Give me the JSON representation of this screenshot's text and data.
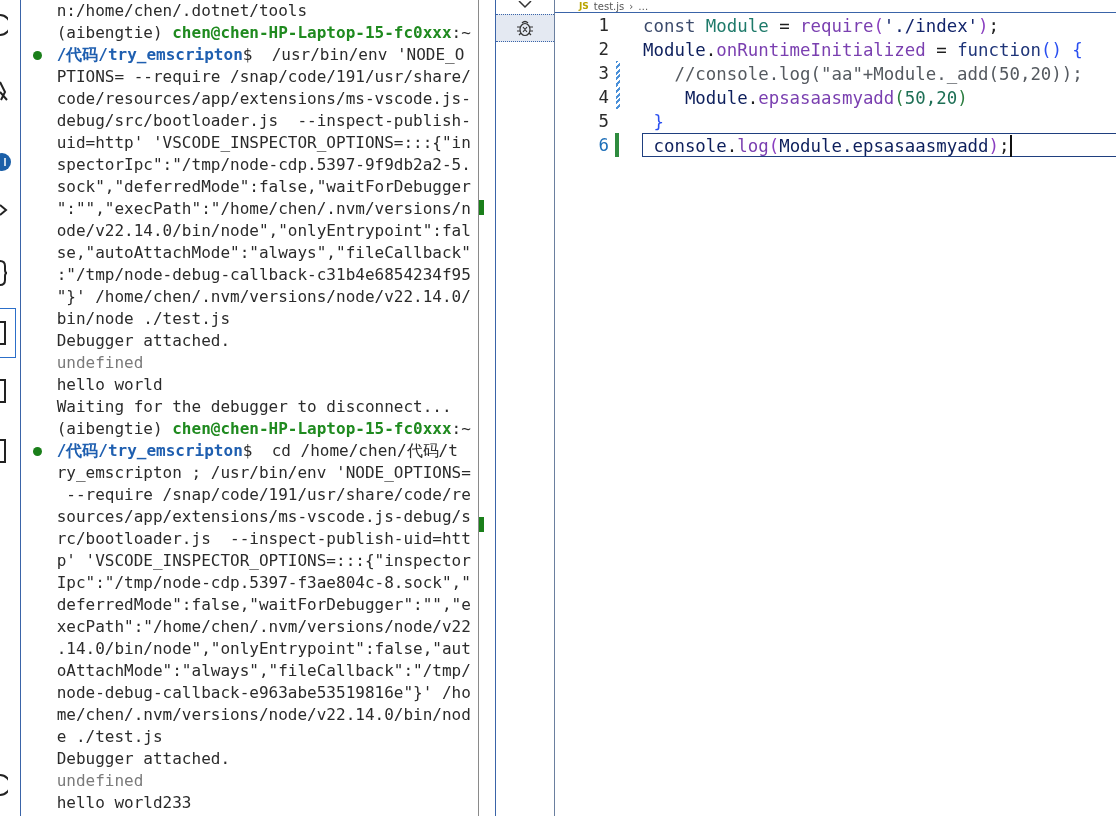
{
  "terminal": {
    "lines": [
      {
        "decoration": false,
        "segments": [
          {
            "text": "n:/home/chen/.dotnet/tools",
            "kind": "plain"
          }
        ]
      },
      {
        "decoration": false,
        "segments": [
          {
            "text": "(aibengtie) ",
            "kind": "plain"
          },
          {
            "text": "chen@chen-HP-Laptop-15-fc0xxx",
            "kind": "user"
          },
          {
            "text": ":~",
            "kind": "plain"
          }
        ]
      },
      {
        "decoration": true,
        "segments": [
          {
            "text": "/代码/try_emscripton",
            "kind": "path"
          },
          {
            "text": "$  /usr/bin/env 'NODE_O",
            "kind": "plain"
          }
        ]
      },
      {
        "decoration": false,
        "segments": [
          {
            "text": "PTIONS= --require /snap/code/191/usr/share/",
            "kind": "plain"
          }
        ]
      },
      {
        "decoration": false,
        "segments": [
          {
            "text": "code/resources/app/extensions/ms-vscode.js-",
            "kind": "plain"
          }
        ]
      },
      {
        "decoration": false,
        "segments": [
          {
            "text": "debug/src/bootloader.js  --inspect-publish-",
            "kind": "plain"
          }
        ]
      },
      {
        "decoration": false,
        "segments": [
          {
            "text": "uid=http' 'VSCODE_INSPECTOR_OPTIONS=:::{\"in",
            "kind": "plain"
          }
        ]
      },
      {
        "decoration": false,
        "segments": [
          {
            "text": "spectorIpc\":\"/tmp/node-cdp.5397-9f9db2a2-5.",
            "kind": "plain"
          }
        ]
      },
      {
        "decoration": false,
        "segments": [
          {
            "text": "sock\",\"deferredMode\":false,\"waitForDebugger",
            "kind": "plain"
          }
        ]
      },
      {
        "decoration": false,
        "segments": [
          {
            "text": "\":\"\",\"execPath\":\"/home/chen/.nvm/versions/n",
            "kind": "plain"
          }
        ]
      },
      {
        "decoration": false,
        "segments": [
          {
            "text": "ode/v22.14.0/bin/node\",\"onlyEntrypoint\":fal",
            "kind": "plain"
          }
        ]
      },
      {
        "decoration": false,
        "segments": [
          {
            "text": "se,\"autoAttachMode\":\"always\",\"fileCallback\"",
            "kind": "plain"
          }
        ]
      },
      {
        "decoration": false,
        "segments": [
          {
            "text": ":\"/tmp/node-debug-callback-c31b4e6854234f95",
            "kind": "plain"
          }
        ]
      },
      {
        "decoration": false,
        "segments": [
          {
            "text": "\"}' /home/chen/.nvm/versions/node/v22.14.0/",
            "kind": "plain"
          }
        ]
      },
      {
        "decoration": false,
        "segments": [
          {
            "text": "bin/node ./test.js",
            "kind": "plain"
          }
        ]
      },
      {
        "decoration": false,
        "segments": [
          {
            "text": "Debugger attached.",
            "kind": "plain"
          }
        ]
      },
      {
        "decoration": false,
        "segments": [
          {
            "text": "undefined",
            "kind": "dim"
          }
        ]
      },
      {
        "decoration": false,
        "segments": [
          {
            "text": "hello world",
            "kind": "plain"
          }
        ]
      },
      {
        "decoration": false,
        "segments": [
          {
            "text": "Waiting for the debugger to disconnect...",
            "kind": "plain"
          }
        ]
      },
      {
        "decoration": false,
        "segments": [
          {
            "text": "(aibengtie) ",
            "kind": "plain"
          },
          {
            "text": "chen@chen-HP-Laptop-15-fc0xxx",
            "kind": "user"
          },
          {
            "text": ":~",
            "kind": "plain"
          }
        ]
      },
      {
        "decoration": true,
        "segments": [
          {
            "text": "/代码/try_emscripton",
            "kind": "path"
          },
          {
            "text": "$  cd /home/chen/代码/t",
            "kind": "plain"
          }
        ]
      },
      {
        "decoration": false,
        "segments": [
          {
            "text": "ry_emscripton ; /usr/bin/env 'NODE_OPTIONS=",
            "kind": "plain"
          }
        ]
      },
      {
        "decoration": false,
        "segments": [
          {
            "text": " --require /snap/code/191/usr/share/code/re",
            "kind": "plain"
          }
        ]
      },
      {
        "decoration": false,
        "segments": [
          {
            "text": "sources/app/extensions/ms-vscode.js-debug/s",
            "kind": "plain"
          }
        ]
      },
      {
        "decoration": false,
        "segments": [
          {
            "text": "rc/bootloader.js  --inspect-publish-uid=htt",
            "kind": "plain"
          }
        ]
      },
      {
        "decoration": false,
        "segments": [
          {
            "text": "p' 'VSCODE_INSPECTOR_OPTIONS=:::{\"inspector",
            "kind": "plain"
          }
        ]
      },
      {
        "decoration": false,
        "segments": [
          {
            "text": "Ipc\":\"/tmp/node-cdp.5397-f3ae804c-8.sock\",\"",
            "kind": "plain"
          }
        ]
      },
      {
        "decoration": false,
        "segments": [
          {
            "text": "deferredMode\":false,\"waitForDebugger\":\"\",\"e",
            "kind": "plain"
          }
        ]
      },
      {
        "decoration": false,
        "segments": [
          {
            "text": "xecPath\":\"/home/chen/.nvm/versions/node/v22",
            "kind": "plain"
          }
        ]
      },
      {
        "decoration": false,
        "segments": [
          {
            "text": ".14.0/bin/node\",\"onlyEntrypoint\":false,\"aut",
            "kind": "plain"
          }
        ]
      },
      {
        "decoration": false,
        "segments": [
          {
            "text": "oAttachMode\":\"always\",\"fileCallback\":\"/tmp/",
            "kind": "plain"
          }
        ]
      },
      {
        "decoration": false,
        "segments": [
          {
            "text": "node-debug-callback-e963abe53519816e\"}' /ho",
            "kind": "plain"
          }
        ]
      },
      {
        "decoration": false,
        "segments": [
          {
            "text": "me/chen/.nvm/versions/node/v22.14.0/bin/nod",
            "kind": "plain"
          }
        ]
      },
      {
        "decoration": false,
        "segments": [
          {
            "text": "e ./test.js",
            "kind": "plain"
          }
        ]
      },
      {
        "decoration": false,
        "segments": [
          {
            "text": "Debugger attached.",
            "kind": "plain"
          }
        ]
      },
      {
        "decoration": false,
        "segments": [
          {
            "text": "undefined",
            "kind": "dim"
          }
        ]
      },
      {
        "decoration": false,
        "segments": [
          {
            "text": "hello world233",
            "kind": "plain"
          }
        ]
      }
    ]
  },
  "side_panel": {
    "items": [
      {
        "kind": "chevron",
        "selected": false
      },
      {
        "kind": "debug",
        "selected": true
      }
    ]
  },
  "editor": {
    "breadcrumb": {
      "file_icon": "JS",
      "file": "test.js",
      "separator": "›",
      "rest": "…"
    },
    "lines": [
      {
        "number": "1",
        "selected": false,
        "kind": "plain",
        "tokens": [
          {
            "text": "const ",
            "kind": "keyword"
          },
          {
            "text": "Module",
            "kind": "type"
          },
          {
            "text": " = ",
            "kind": "plain"
          },
          {
            "text": "require",
            "kind": "function"
          },
          {
            "text": "(",
            "kind": "bracket2"
          },
          {
            "text": "'./index'",
            "kind": "string"
          },
          {
            "text": ")",
            "kind": "bracket2"
          },
          {
            "text": ";",
            "kind": "plain"
          }
        ]
      },
      {
        "number": "2",
        "selected": false,
        "kind": "plain",
        "tokens": [
          {
            "text": "Module",
            "kind": "variable"
          },
          {
            "text": ".",
            "kind": "plain"
          },
          {
            "text": "onRuntimeInitialized",
            "kind": "function"
          },
          {
            "text": " = ",
            "kind": "plain"
          },
          {
            "text": "function",
            "kind": "keyword2"
          },
          {
            "text": "()",
            "kind": "bracket1"
          },
          {
            "text": " {",
            "kind": "bracket1"
          }
        ]
      },
      {
        "number": "3",
        "selected": false,
        "kind": "modified",
        "tokens": [
          {
            "text": "   //console.log(\"aa\"+Module._add(50,20));",
            "kind": "comment"
          }
        ]
      },
      {
        "number": "4",
        "selected": false,
        "kind": "modified",
        "tokens": [
          {
            "text": "    Module",
            "kind": "variable"
          },
          {
            "text": ".",
            "kind": "plain"
          },
          {
            "text": "epsasaasmyadd",
            "kind": "function"
          },
          {
            "text": "(",
            "kind": "bracket3"
          },
          {
            "text": "50,20",
            "kind": "number"
          },
          {
            "text": ")",
            "kind": "bracket3"
          }
        ]
      },
      {
        "number": "5",
        "selected": false,
        "kind": "plain",
        "tokens": [
          {
            "text": " }",
            "kind": "bracket1"
          }
        ]
      },
      {
        "number": "6",
        "selected": true,
        "kind": "added",
        "tokens": [
          {
            "text": " console",
            "kind": "variable"
          },
          {
            "text": ".",
            "kind": "plain"
          },
          {
            "text": "log",
            "kind": "function"
          },
          {
            "text": "(",
            "kind": "bracket2"
          },
          {
            "text": "Module.epsasaasmyadd",
            "kind": "variable"
          },
          {
            "text": ")",
            "kind": "bracket2"
          },
          {
            "text": ";",
            "kind": "plain"
          }
        ]
      }
    ]
  }
}
